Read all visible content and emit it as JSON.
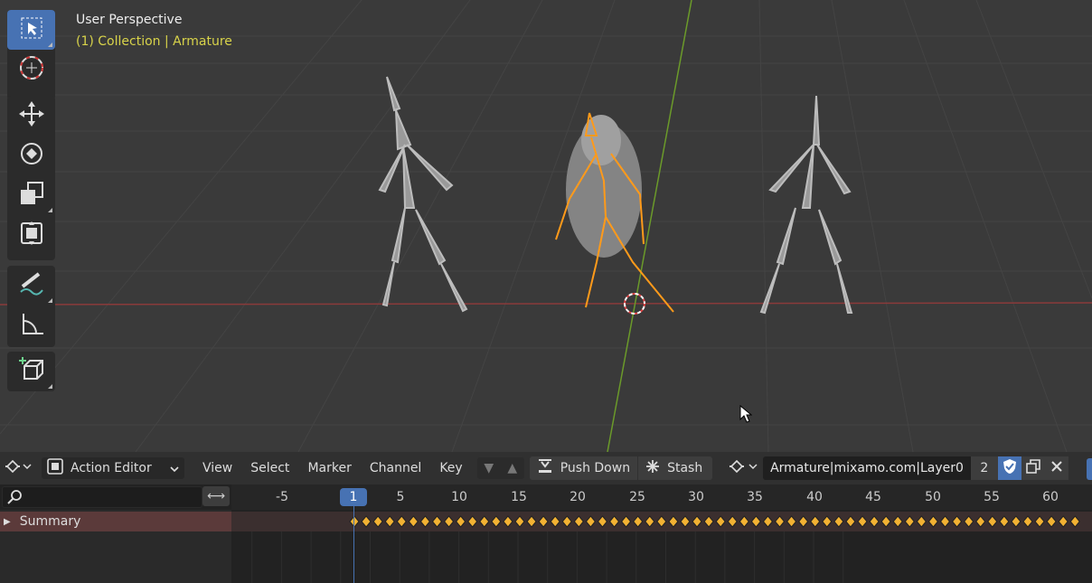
{
  "viewport": {
    "title": "User Perspective",
    "subtitle": "(1) Collection | Armature"
  },
  "tools": [
    {
      "name": "select-box-icon",
      "active": true
    },
    {
      "name": "cursor-icon",
      "active": false
    },
    {
      "name": "move-icon",
      "active": false
    },
    {
      "name": "rotate-icon",
      "active": false
    },
    {
      "name": "scale-icon",
      "active": false
    },
    {
      "name": "transform-icon",
      "active": false
    },
    {
      "name": "annotate-icon",
      "active": false
    },
    {
      "name": "measure-icon",
      "active": false
    },
    {
      "name": "add-cube-icon",
      "active": false
    }
  ],
  "editor": {
    "mode_label": "Action Editor",
    "menus": [
      "View",
      "Select",
      "Marker",
      "Channel",
      "Key"
    ],
    "push_down_label": "Push Down",
    "stash_label": "Stash",
    "action_name": "Armature|mixamo.com|Layer0",
    "users_count": "2",
    "summary_label": "Summary",
    "current_frame": "1",
    "ticks": [
      "-5",
      "5",
      "10",
      "15",
      "20",
      "25",
      "30",
      "35",
      "40",
      "45",
      "50",
      "55",
      "60"
    ]
  },
  "colors": {
    "accent": "#4772b3",
    "selected_armature": "#ff9a1a",
    "keyframe": "#f2b233",
    "x_axis": "#b04a4a",
    "y_axis": "#6b9a2a"
  }
}
